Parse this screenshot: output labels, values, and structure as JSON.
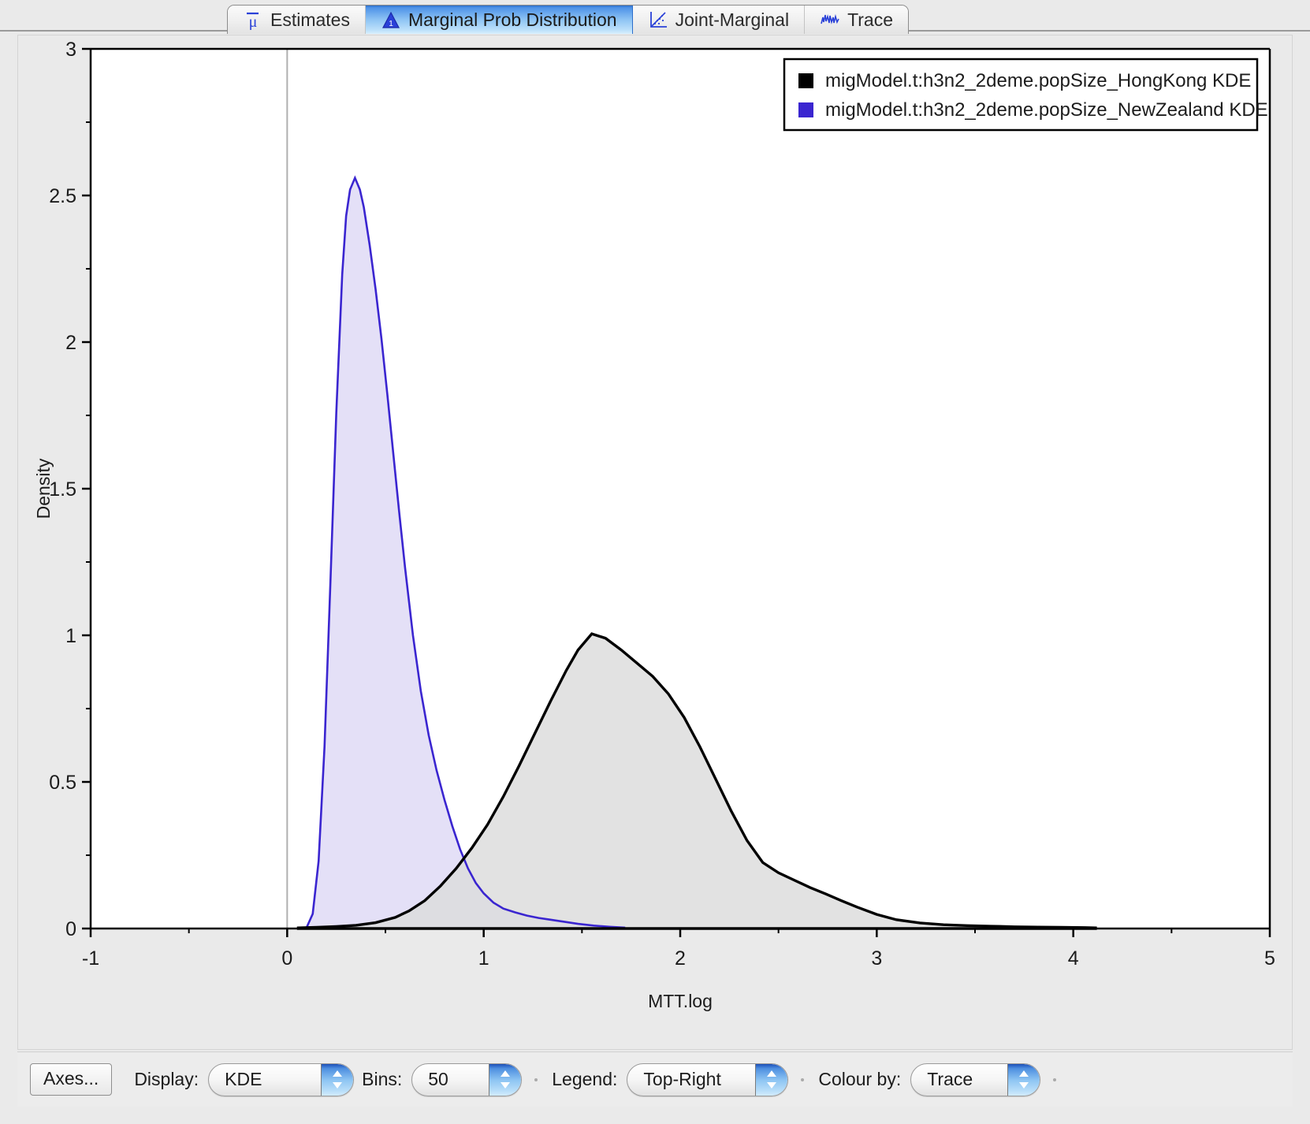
{
  "window": {
    "title": "Marginal Prob Distribution"
  },
  "tabs": [
    {
      "label": "Estimates",
      "icon": "mu-bar-icon",
      "active": false
    },
    {
      "label": "Marginal Prob Distribution",
      "icon": "distribution-icon",
      "active": true
    },
    {
      "label": "Joint-Marginal",
      "icon": "scatter-plot-icon",
      "active": false
    },
    {
      "label": "Trace",
      "icon": "trace-line-icon",
      "active": false
    }
  ],
  "toolbar": {
    "axes_button": "Axes...",
    "display_label": "Display:",
    "display_value": "KDE",
    "display_options": [
      "KDE"
    ],
    "bins_label": "Bins:",
    "bins_value": "50",
    "legend_label": "Legend:",
    "legend_value": "Top-Right",
    "colour_by_label": "Colour by:",
    "colour_by_value": "Trace"
  },
  "chart_data": {
    "type": "area",
    "title": "",
    "xlabel": "MTT.log",
    "ylabel": "Density",
    "xlim": [
      -1,
      5
    ],
    "ylim": [
      0,
      3
    ],
    "xticks": [
      -1,
      0,
      1,
      2,
      3,
      4,
      5
    ],
    "xticklabels": [
      "-1",
      "0",
      "1",
      "2",
      "3",
      "4",
      "5"
    ],
    "yticks": [
      0,
      0.5,
      1,
      1.5,
      2,
      2.5,
      3
    ],
    "yticklabels": [
      "0",
      "0.5",
      "1",
      "1.5",
      "2",
      "2.5",
      "3"
    ],
    "x_minor_ticks": [
      -0.5,
      0.5,
      1.5,
      2.5,
      3.5,
      4.5
    ],
    "y_minor_ticks": [
      0.25,
      0.75,
      1.25,
      1.75,
      2.25,
      2.75
    ],
    "grid": false,
    "vertical_reference_line_x": 0,
    "legend_position": "Top-Right",
    "legend": [
      {
        "label": "migModel.t:h3n2_2deme.popSize_HongKong KDE",
        "stroke": "#000000",
        "fill": "#dcdcdc",
        "swatch": "#000000"
      },
      {
        "label": "migModel.t:h3n2_2deme.popSize_NewZealand KDE",
        "stroke": "#3a25d0",
        "fill": "#e4e0f7",
        "swatch": "#3a25d0"
      }
    ],
    "series": [
      {
        "name": "migModel.t:h3n2_2deme.popSize_HongKong KDE",
        "stroke": "#000000",
        "fill": "#dcdcdc",
        "peak_x": 1.55,
        "peak_y": 1.005,
        "x": [
          0.05,
          0.15,
          0.25,
          0.35,
          0.45,
          0.55,
          0.62,
          0.7,
          0.78,
          0.86,
          0.94,
          1.02,
          1.1,
          1.18,
          1.26,
          1.34,
          1.42,
          1.48,
          1.55,
          1.62,
          1.7,
          1.78,
          1.86,
          1.94,
          2.02,
          2.1,
          2.18,
          2.26,
          2.34,
          2.42,
          2.5,
          2.58,
          2.66,
          2.74,
          2.82,
          2.9,
          3.0,
          3.1,
          3.22,
          3.34,
          3.46,
          3.58,
          3.7,
          3.82,
          3.94,
          4.06,
          4.12
        ],
        "y": [
          0.002,
          0.004,
          0.007,
          0.011,
          0.02,
          0.038,
          0.06,
          0.095,
          0.145,
          0.205,
          0.275,
          0.355,
          0.45,
          0.555,
          0.665,
          0.775,
          0.88,
          0.95,
          1.005,
          0.99,
          0.95,
          0.905,
          0.86,
          0.8,
          0.72,
          0.62,
          0.51,
          0.4,
          0.3,
          0.225,
          0.19,
          0.165,
          0.14,
          0.118,
          0.095,
          0.073,
          0.048,
          0.03,
          0.019,
          0.013,
          0.01,
          0.008,
          0.006,
          0.005,
          0.004,
          0.003,
          0.002
        ]
      },
      {
        "name": "migModel.t:h3n2_2deme.popSize_NewZealand KDE",
        "stroke": "#3a25d0",
        "fill": "#e4e0f7",
        "peak_x": 0.345,
        "peak_y": 2.56,
        "x": [
          0.1,
          0.13,
          0.16,
          0.19,
          0.22,
          0.25,
          0.28,
          0.3,
          0.32,
          0.345,
          0.37,
          0.39,
          0.42,
          0.45,
          0.48,
          0.51,
          0.54,
          0.57,
          0.6,
          0.64,
          0.68,
          0.72,
          0.76,
          0.8,
          0.84,
          0.88,
          0.92,
          0.96,
          1.0,
          1.05,
          1.1,
          1.16,
          1.22,
          1.28,
          1.34,
          1.4,
          1.48,
          1.56,
          1.64,
          1.72
        ],
        "y": [
          0.005,
          0.05,
          0.23,
          0.62,
          1.18,
          1.76,
          2.23,
          2.43,
          2.52,
          2.56,
          2.52,
          2.46,
          2.33,
          2.18,
          2.01,
          1.82,
          1.62,
          1.42,
          1.23,
          1.0,
          0.81,
          0.66,
          0.54,
          0.44,
          0.35,
          0.27,
          0.205,
          0.155,
          0.12,
          0.088,
          0.068,
          0.055,
          0.044,
          0.036,
          0.03,
          0.024,
          0.016,
          0.01,
          0.006,
          0.003
        ]
      }
    ]
  }
}
